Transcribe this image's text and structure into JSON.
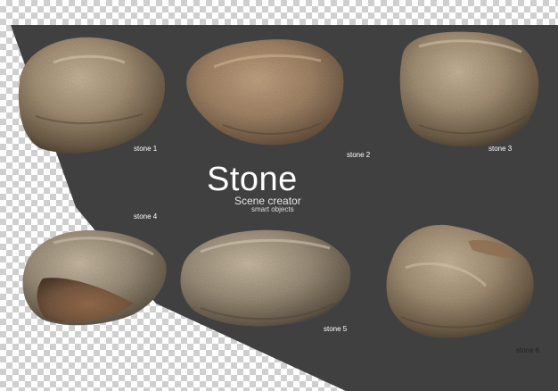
{
  "heading": {
    "title": "Stone",
    "subtitle": "Scene creator",
    "tagline": "smart objects"
  },
  "stones": [
    {
      "label": "stone 1"
    },
    {
      "label": "stone 2"
    },
    {
      "label": "stone 3"
    },
    {
      "label": "stone 4"
    },
    {
      "label": "stone 5"
    },
    {
      "label": "stone 6"
    }
  ],
  "colors": {
    "backdrop": "#404040",
    "checker_light": "#ffffff",
    "checker_dark": "#cfcfcf",
    "stone_base": "#a08c70",
    "stone_shadow": "#5e4e3c"
  }
}
